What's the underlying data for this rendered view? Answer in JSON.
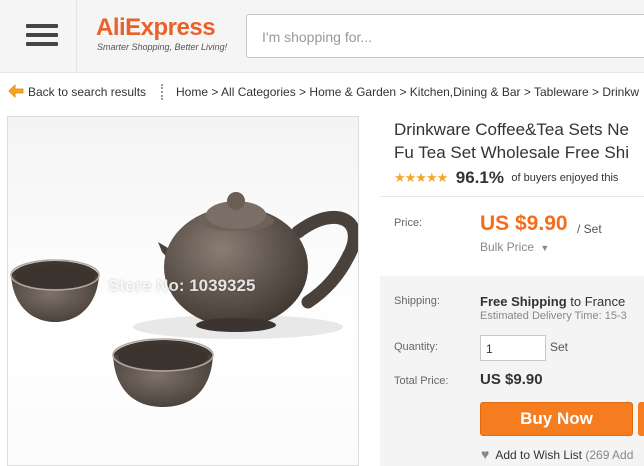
{
  "header": {
    "logo_main": "AliExpress",
    "logo_tagline": "Smarter Shopping, Better Living!",
    "search_placeholder": "I'm shopping for..."
  },
  "nav": {
    "back_label": "Back to search results",
    "breadcrumb": "Home > All Categories > Home & Garden > Kitchen,Dining & Bar > Tableware > Drinkw"
  },
  "gallery": {
    "watermark": "Store No: 1039325"
  },
  "product": {
    "title_line1": "Drinkware Coffee&Tea Sets Ne",
    "title_line2": "Fu Tea Set Wholesale Free Shi",
    "stars": "★★★★★",
    "positive_pct": "96.1%",
    "positive_text": "of buyers enjoyed this"
  },
  "pricing": {
    "price_label": "Price:",
    "price": "US $9.90",
    "unit": "/ Set",
    "bulk_label": "Bulk Price"
  },
  "shipping": {
    "label": "Shipping:",
    "value_bold": "Free Shipping",
    "value_rest": " to France",
    "estimate": "Estimated Delivery Time: 15-3"
  },
  "quantity": {
    "label": "Quantity:",
    "value": "1",
    "unit": "Set"
  },
  "total": {
    "label": "Total Price:",
    "value": "US $9.90"
  },
  "actions": {
    "buy_now": "Buy Now",
    "wish_label": "Add to Wish List",
    "wish_count": "(269 Add"
  },
  "colors": {
    "accent_orange": "#f57c1f",
    "price_orange": "#f46c1c",
    "star_gold": "#f5a623"
  }
}
